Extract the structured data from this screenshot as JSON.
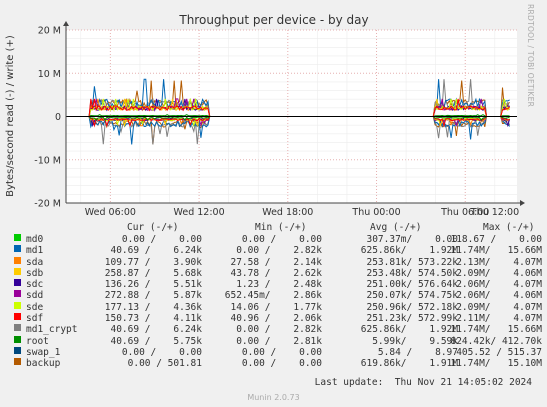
{
  "chart_data": {
    "type": "line",
    "title": "Throughput per device - by day",
    "ylabel": "Bytes/second read (-) / write (+)",
    "y_ticks": [
      "20 M",
      "10 M",
      "0",
      "-10 M",
      "-20 M"
    ],
    "ylim": [
      -20000000,
      20000000
    ],
    "x_ticks": [
      "Wed 06:00",
      "Wed 12:00",
      "Wed 18:00",
      "Thu 00:00",
      "Thu 06:00",
      "Thu 12:00"
    ],
    "x_range_hours": [
      3,
      33.5
    ],
    "grid": true,
    "activity_windows_hours": [
      [
        4.6,
        12.6
      ],
      [
        27.9,
        31.4
      ],
      [
        32.5,
        33.4
      ]
    ],
    "peak_write_bytes_per_sec": 14000000,
    "peak_read_bytes_per_sec": -11500000,
    "series": [
      {
        "name": "md0",
        "color": "#00cc00",
        "cur": "0.00 /    0.00",
        "min": "0.00 /    0.00",
        "avg": "307.37m/    0.00",
        "max": "118.67 /    0.00"
      },
      {
        "name": "md1",
        "color": "#0066b3",
        "cur": "40.69 /    6.24k",
        "min": "0.00 /    2.82k",
        "avg": "625.86k/    1.92M",
        "max": "11.74M/   15.66M"
      },
      {
        "name": "sda",
        "color": "#ff8000",
        "cur": "109.77 /    3.90k",
        "min": "27.58 /    2.14k",
        "avg": "253.81k/ 573.22k",
        "max": "2.13M/    4.07M"
      },
      {
        "name": "sdb",
        "color": "#ffcc00",
        "cur": "258.87 /    5.68k",
        "min": "43.78 /    2.62k",
        "avg": "253.48k/ 574.50k",
        "max": "2.09M/    4.06M"
      },
      {
        "name": "sdc",
        "color": "#330099",
        "cur": "136.26 /    5.51k",
        "min": "1.23 /    2.48k",
        "avg": "251.00k/ 576.64k",
        "max": "2.06M/    4.07M"
      },
      {
        "name": "sdd",
        "color": "#990099",
        "cur": "272.88 /    5.87k",
        "min": "652.45m/    2.86k",
        "avg": "250.07k/ 574.75k",
        "max": "2.06M/    4.06M"
      },
      {
        "name": "sde",
        "color": "#ccff00",
        "cur": "177.13 /    4.36k",
        "min": "14.06 /    1.77k",
        "avg": "250.96k/ 572.18k",
        "max": "2.09M/    4.07M"
      },
      {
        "name": "sdf",
        "color": "#ff0000",
        "cur": "150.73 /    4.11k",
        "min": "40.96 /    2.06k",
        "avg": "251.23k/ 572.99k",
        "max": "2.11M/    4.07M"
      },
      {
        "name": "md1_crypt",
        "color": "#808080",
        "cur": "40.69 /    6.24k",
        "min": "0.00 /    2.82k",
        "avg": "625.86k/    1.92M",
        "max": "11.74M/   15.66M"
      },
      {
        "name": "root",
        "color": "#008f00",
        "cur": "40.69 /    5.75k",
        "min": "0.00 /    2.81k",
        "avg": "5.99k/    9.59k",
        "max": "824.42k/ 412.70k"
      },
      {
        "name": "swap_1",
        "color": "#00487d",
        "cur": "0.00 /    0.00",
        "min": "0.00 /    0.00",
        "avg": "5.84 /    8.97",
        "max": "405.52 / 515.37"
      },
      {
        "name": "backup",
        "color": "#b35a00",
        "cur": "0.00 / 501.81",
        "min": "0.00 /    0.00",
        "avg": "619.86k/    1.91M",
        "max": "11.74M/   15.10M"
      }
    ]
  },
  "legend_headers": {
    "cur": "Cur (-/+)",
    "min": "Min (-/+)",
    "avg": "Avg (-/+)",
    "max": "Max (-/+)"
  },
  "footer": {
    "last_update": "Last update:  Thu Nov 21 14:05:02 2024",
    "version": "Munin 2.0.73",
    "watermark": "RRDTOOL / TOBI OETIKER"
  }
}
